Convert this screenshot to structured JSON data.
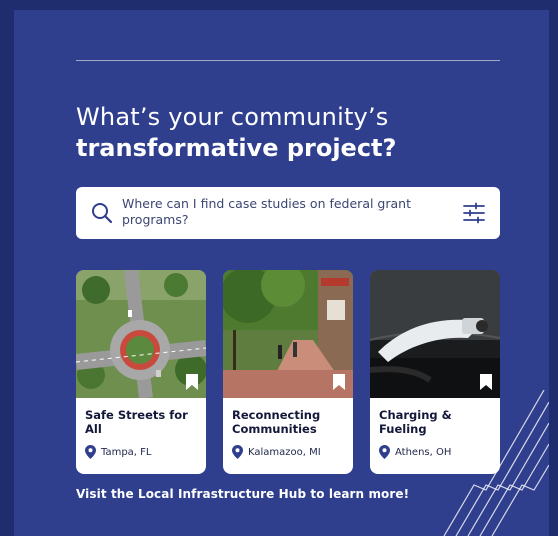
{
  "headline": {
    "line1": "What’s your community’s",
    "line2": "transformative project?"
  },
  "search": {
    "query": "Where can I find case studies on federal grant programs?",
    "search_icon": "search-icon",
    "filter_icon": "filter-sliders-icon"
  },
  "cards": [
    {
      "title": "Safe Streets for All",
      "location": "Tampa, FL",
      "image": "roundabout-aerial-photo"
    },
    {
      "title": "Reconnecting Communities",
      "location": "Kalamazoo, MI",
      "image": "tree-lined-sidewalk-photo"
    },
    {
      "title": "Charging & Fueling",
      "location": "Athens, OH",
      "image": "ev-charger-photo"
    }
  ],
  "cta": "Visit the Local Infrastructure Hub to learn more!",
  "colors": {
    "background": "#2f3f8e",
    "card": "#ffffff",
    "text_dark": "#14183a"
  }
}
